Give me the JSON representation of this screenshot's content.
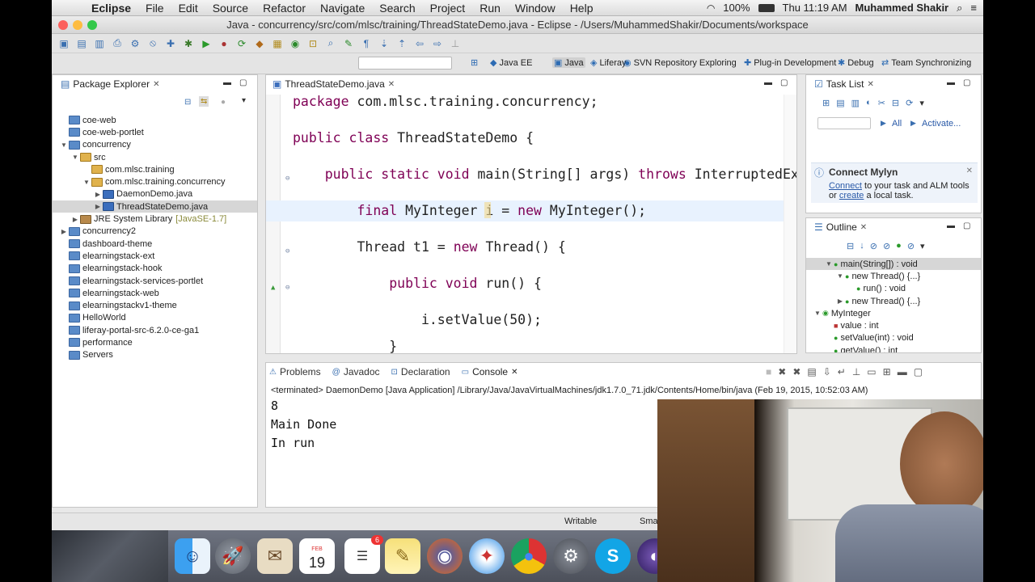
{
  "menubar": {
    "app": "Eclipse",
    "items": [
      "File",
      "Edit",
      "Source",
      "Refactor",
      "Navigate",
      "Search",
      "Project",
      "Run",
      "Window",
      "Help"
    ],
    "battery": "100%",
    "clock": "Thu 11:19 AM",
    "user": "Muhammed Shakir"
  },
  "window": {
    "title": "Java - concurrency/src/com/mlsc/training/ThreadStateDemo.java - Eclipse - /Users/MuhammedShakir/Documents/workspace"
  },
  "perspectives": [
    "Java EE",
    "Java",
    "Liferay",
    "SVN Repository Exploring",
    "Plug-in Development",
    "Debug",
    "Team Synchronizing"
  ],
  "package_explorer": {
    "title": "Package Explorer",
    "items": [
      {
        "label": "coe-web",
        "depth": 0,
        "icon": "folder-icon"
      },
      {
        "label": "coe-web-portlet",
        "depth": 0,
        "icon": "folder-icon"
      },
      {
        "label": "concurrency",
        "depth": 0,
        "icon": "folder-icon",
        "expanded": true
      },
      {
        "label": "src",
        "depth": 1,
        "icon": "package-icon",
        "expanded": true
      },
      {
        "label": "com.mlsc.training",
        "depth": 2,
        "icon": "package-icon"
      },
      {
        "label": "com.mlsc.training.concurrency",
        "depth": 2,
        "icon": "package-icon",
        "expanded": true
      },
      {
        "label": "DaemonDemo.java",
        "depth": 3,
        "icon": "java-file-icon",
        "collapsed": true
      },
      {
        "label": "ThreadStateDemo.java",
        "depth": 3,
        "icon": "java-file-icon",
        "collapsed": true,
        "selected": true
      },
      {
        "label": "JRE System Library",
        "suffix": "[JavaSE-1.7]",
        "depth": 1,
        "icon": "library-icon",
        "collapsed": true
      },
      {
        "label": "concurrency2",
        "depth": 0,
        "icon": "folder-icon",
        "collapsed": true
      },
      {
        "label": "dashboard-theme",
        "depth": 0,
        "icon": "folder-icon"
      },
      {
        "label": "elearningstack-ext",
        "depth": 0,
        "icon": "folder-icon"
      },
      {
        "label": "elearningstack-hook",
        "depth": 0,
        "icon": "folder-icon"
      },
      {
        "label": "elearningstack-services-portlet",
        "depth": 0,
        "icon": "folder-icon"
      },
      {
        "label": "elearningstack-web",
        "depth": 0,
        "icon": "folder-icon"
      },
      {
        "label": "elearningstackv1-theme",
        "depth": 0,
        "icon": "folder-icon"
      },
      {
        "label": "HelloWorld",
        "depth": 0,
        "icon": "folder-icon"
      },
      {
        "label": "liferay-portal-src-6.2.0-ce-ga1",
        "depth": 0,
        "icon": "folder-icon"
      },
      {
        "label": "performance",
        "depth": 0,
        "icon": "folder-icon"
      },
      {
        "label": "Servers",
        "depth": 0,
        "icon": "folder-icon"
      }
    ]
  },
  "editor": {
    "tab": "ThreadStateDemo.java",
    "lines": [
      [
        {
          "t": "package ",
          "k": 1
        },
        {
          "t": "com.mlsc.training.concurrency;"
        }
      ],
      [
        {
          "t": "public class ",
          "k": 1
        },
        {
          "t": "ThreadStateDemo {"
        }
      ],
      [
        {
          "t": "    public static void ",
          "k": 1
        },
        {
          "t": "main(String[] args) "
        },
        {
          "t": "throws ",
          "k": 1
        },
        {
          "t": "InterruptedEx"
        }
      ],
      [
        {
          "t": "        final ",
          "k": 1
        },
        {
          "t": "MyInteger i = "
        },
        {
          "t": "new ",
          "k": 1
        },
        {
          "t": "MyInteger();"
        }
      ],
      [
        {
          "t": "        Thread t1 = "
        },
        {
          "t": "new ",
          "k": 1
        },
        {
          "t": "Thread() {"
        }
      ],
      [
        {
          "t": "            public void ",
          "k": 1
        },
        {
          "t": "run() {"
        }
      ],
      [
        {
          "t": "                i.setValue(50);"
        }
      ],
      [
        {
          "t": "            }"
        }
      ]
    ]
  },
  "task_list": {
    "title": "Task List",
    "all": "All",
    "activate": "Activate...",
    "connect_title": "Connect Mylyn",
    "connect_link": "Connect",
    "connect_text1": " to your task and ALM tools",
    "connect_or": "or ",
    "create_link": "create",
    "connect_text2": " a local task."
  },
  "outline": {
    "title": "Outline",
    "items": [
      {
        "label": "main(String[]) : void",
        "depth": 1,
        "expanded": true,
        "selected": true
      },
      {
        "label": "new Thread() {...}",
        "depth": 2,
        "expanded": true
      },
      {
        "label": "run() : void",
        "depth": 3
      },
      {
        "label": "new Thread() {...}",
        "depth": 2,
        "collapsed": true
      },
      {
        "label": "MyInteger",
        "depth": 0,
        "expanded": true
      },
      {
        "label": "value : int",
        "depth": 1
      },
      {
        "label": "setValue(int) : void",
        "depth": 1
      },
      {
        "label": "getValue() : int",
        "depth": 1
      }
    ]
  },
  "console": {
    "tabs": [
      "Problems",
      "Javadoc",
      "Declaration",
      "Console"
    ],
    "active": "Console",
    "header": "<terminated> DaemonDemo [Java Application] /Library/Java/JavaVirtualMachines/jdk1.7.0_71.jdk/Contents/Home/bin/java (Feb 19, 2015, 10:52:03 AM)",
    "output": [
      "8",
      "Main Done",
      "In run"
    ]
  },
  "status": {
    "writable": "Writable",
    "insert": "Sma"
  },
  "dock": {
    "calendar_month": "FEB",
    "calendar_day": "19",
    "reminders_badge": "6"
  }
}
